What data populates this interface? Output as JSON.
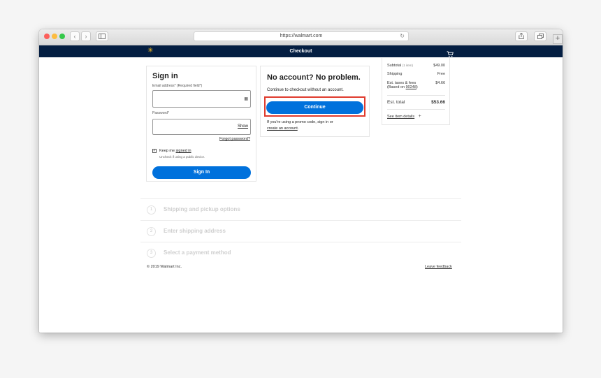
{
  "browser": {
    "url": "https://walmart.com"
  },
  "header": {
    "title": "Checkout"
  },
  "signin": {
    "title": "Sign in",
    "email_label": "Email address* (Required field*)",
    "email_value": "",
    "password_label": "Password*",
    "password_value": "",
    "show_label": "Show",
    "forgot_label": "Forgot password?",
    "keep_prefix": "Keep me ",
    "keep_link": "signed in",
    "keep_hint": "Uncheck if using a public device.",
    "button_label": "Sign In"
  },
  "guest": {
    "title": "No account? No problem.",
    "subtitle": "Continue to checkout without an account.",
    "button_label": "Continue",
    "promo_text": "If you're using a promo code, sign in or",
    "create_link": "create an account",
    "create_suffix": "."
  },
  "summary": {
    "subtotal_label": "Subtotal",
    "subtotal_count": "(1 item)",
    "subtotal_value": "$49.00",
    "shipping_label": "Shipping",
    "shipping_value": "Free",
    "taxes_label": "Est. taxes & fees",
    "taxes_based_prefix": "(Based on ",
    "taxes_zip": "90248",
    "taxes_based_suffix": ")",
    "taxes_value": "$4.66",
    "total_label": "Est. total",
    "total_value": "$53.66",
    "details_link": "See item details",
    "details_icon": "+"
  },
  "steps": [
    {
      "num": "1",
      "label": "Shipping and pickup options"
    },
    {
      "num": "2",
      "label": "Enter shipping address"
    },
    {
      "num": "3",
      "label": "Select a payment method"
    }
  ],
  "footer": {
    "copyright": "© 2019 Walmart Inc.",
    "feedback": "Leave feedback"
  },
  "colors": {
    "header_bg": "#041e42",
    "brand_yellow": "#ffc220",
    "button_blue": "#0071dc",
    "highlight_red": "#e03b2e"
  },
  "icons": {
    "logo": "walmart-spark-icon",
    "cart": "cart-icon",
    "email_field": "keyboard-icon",
    "password_field": "keyboard-icon"
  }
}
